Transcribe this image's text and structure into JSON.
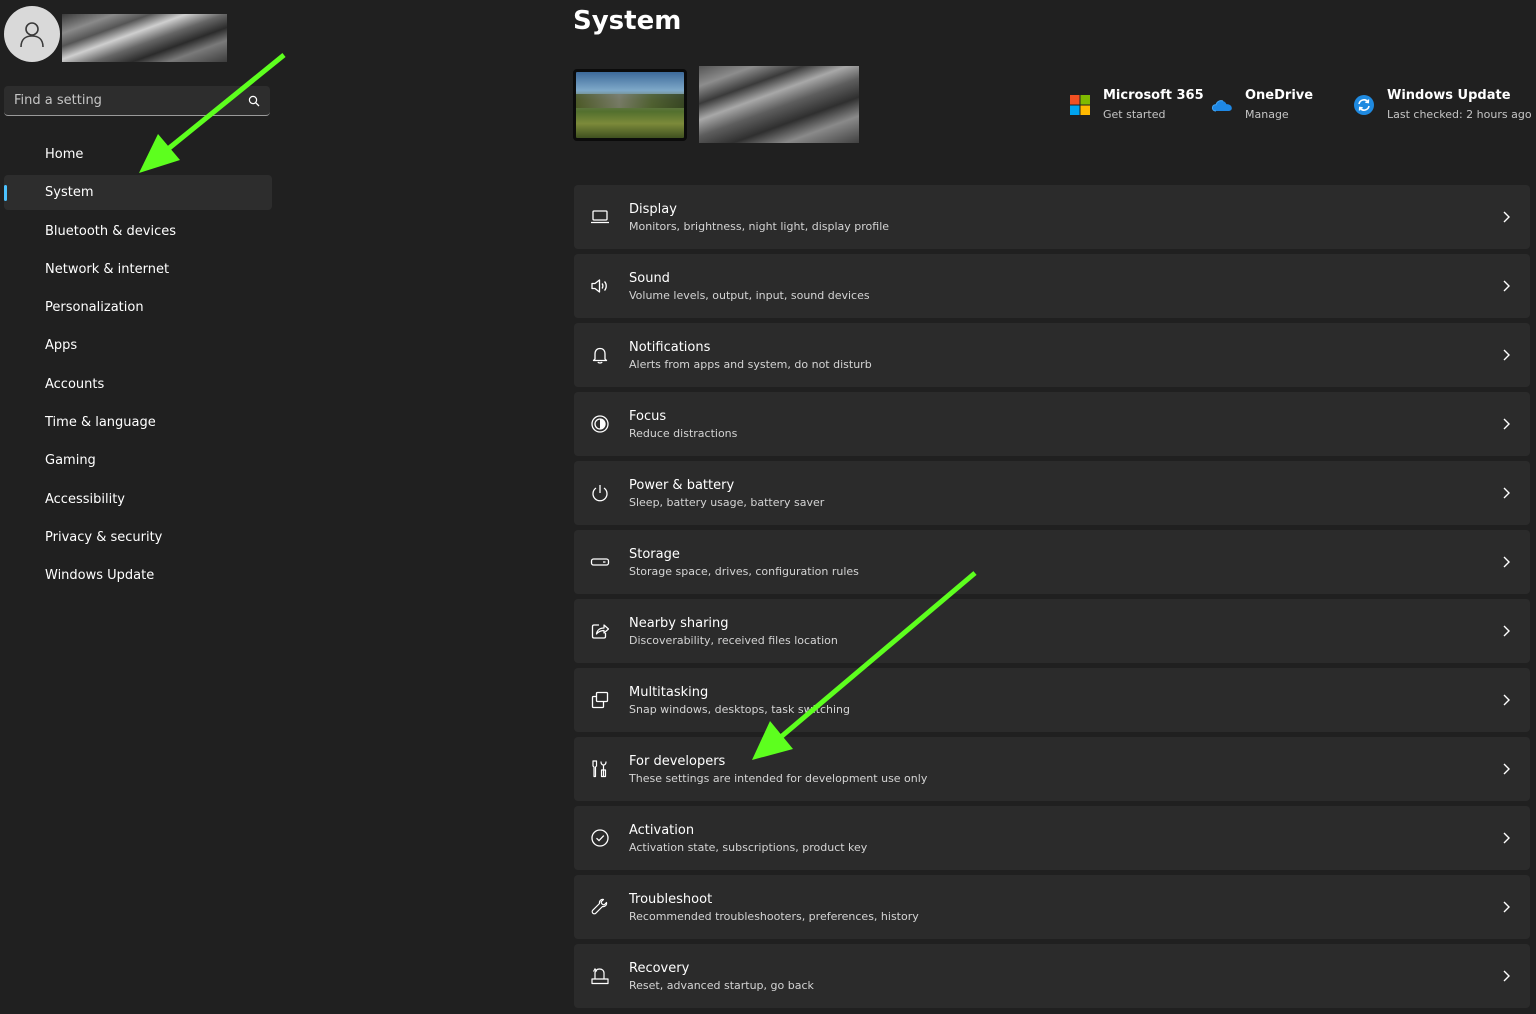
{
  "search": {
    "placeholder": "Find a setting"
  },
  "sidebar": {
    "items": [
      {
        "label": "Home"
      },
      {
        "label": "System"
      },
      {
        "label": "Bluetooth & devices"
      },
      {
        "label": "Network & internet"
      },
      {
        "label": "Personalization"
      },
      {
        "label": "Apps"
      },
      {
        "label": "Accounts"
      },
      {
        "label": "Time & language"
      },
      {
        "label": "Gaming"
      },
      {
        "label": "Accessibility"
      },
      {
        "label": "Privacy & security"
      },
      {
        "label": "Windows Update"
      }
    ],
    "selected": "System"
  },
  "main": {
    "title": "System",
    "quick_links": [
      {
        "title": "Microsoft 365",
        "subtitle": "Get started",
        "icon": "microsoft-365-icon"
      },
      {
        "title": "OneDrive",
        "subtitle": "Manage",
        "icon": "onedrive-cloud-icon"
      },
      {
        "title": "Windows Update",
        "subtitle": "Last checked: 2 hours ago",
        "icon": "windows-update-icon"
      }
    ],
    "cards": [
      {
        "title": "Display",
        "subtitle": "Monitors, brightness, night light, display profile",
        "icon": "display-icon"
      },
      {
        "title": "Sound",
        "subtitle": "Volume levels, output, input, sound devices",
        "icon": "speaker-icon"
      },
      {
        "title": "Notifications",
        "subtitle": "Alerts from apps and system, do not disturb",
        "icon": "bell-icon"
      },
      {
        "title": "Focus",
        "subtitle": "Reduce distractions",
        "icon": "focus-icon"
      },
      {
        "title": "Power & battery",
        "subtitle": "Sleep, battery usage, battery saver",
        "icon": "power-icon"
      },
      {
        "title": "Storage",
        "subtitle": "Storage space, drives, configuration rules",
        "icon": "storage-drive-icon"
      },
      {
        "title": "Nearby sharing",
        "subtitle": "Discoverability, received files location",
        "icon": "share-icon"
      },
      {
        "title": "Multitasking",
        "subtitle": "Snap windows, desktops, task switching",
        "icon": "multitasking-icon"
      },
      {
        "title": "For developers",
        "subtitle": "These settings are intended for development use only",
        "icon": "developer-tools-icon"
      },
      {
        "title": "Activation",
        "subtitle": "Activation state, subscriptions, product key",
        "icon": "checkmark-circle-icon"
      },
      {
        "title": "Troubleshoot",
        "subtitle": "Recommended troubleshooters, preferences, history",
        "icon": "wrench-icon"
      },
      {
        "title": "Recovery",
        "subtitle": "Reset, advanced startup, go back",
        "icon": "recovery-icon"
      }
    ]
  },
  "colors": {
    "background": "#202020",
    "card": "#2b2b2b",
    "selected_nav": "#2d2d2d",
    "accent": "#4cc2ff",
    "annotation_arrow": "#5dff1e"
  }
}
